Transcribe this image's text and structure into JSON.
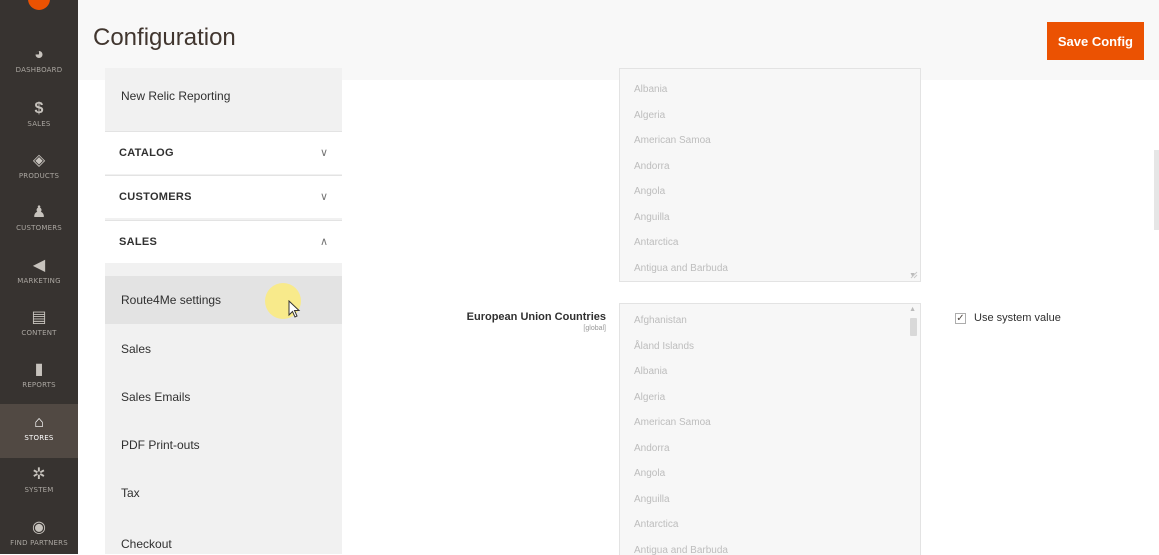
{
  "admin_menu": [
    {
      "label": "DASHBOARD",
      "icon": "dashboard-icon",
      "glyph": "◕"
    },
    {
      "label": "SALES",
      "icon": "dollar-icon",
      "glyph": "$"
    },
    {
      "label": "PRODUCTS",
      "icon": "cube-icon",
      "glyph": "◈"
    },
    {
      "label": "CUSTOMERS",
      "icon": "person-icon",
      "glyph": "♟"
    },
    {
      "label": "MARKETING",
      "icon": "megaphone-icon",
      "glyph": "◀"
    },
    {
      "label": "CONTENT",
      "icon": "layout-icon",
      "glyph": "▤"
    },
    {
      "label": "REPORTS",
      "icon": "bar-chart-icon",
      "glyph": "▮"
    },
    {
      "label": "STORES",
      "icon": "storefront-icon",
      "glyph": "⌂"
    },
    {
      "label": "SYSTEM",
      "icon": "gear-icon",
      "glyph": "✲"
    },
    {
      "label": "FIND PARTNERS",
      "icon": "partners-box-icon",
      "glyph": "◉"
    }
  ],
  "header": {
    "title": "Configuration",
    "save_label": "Save Config"
  },
  "config_nav": {
    "top_item": "New Relic Reporting",
    "sections": [
      {
        "label": "CATALOG",
        "chevron": "∨"
      },
      {
        "label": "CUSTOMERS",
        "chevron": "∨"
      },
      {
        "label": "SALES",
        "chevron": "∧"
      }
    ],
    "sales_items": [
      "Route4Me settings",
      "Sales",
      "Sales Emails",
      "PDF Print-outs",
      "Tax",
      "Checkout"
    ]
  },
  "top_countries": [
    "Albania",
    "Algeria",
    "American Samoa",
    "Andorra",
    "Angola",
    "Anguilla",
    "Antarctica",
    "Antigua and Barbuda"
  ],
  "eu_field": {
    "label": "European Union Countries",
    "scope": "[global]",
    "options": [
      "Afghanistan",
      "Åland Islands",
      "Albania",
      "Algeria",
      "American Samoa",
      "Andorra",
      "Angola",
      "Anguilla",
      "Antarctica",
      "Antigua and Barbuda"
    ],
    "use_system_value": "Use system value",
    "checked": true
  },
  "colors": {
    "accent": "#eb5202",
    "menu_bg": "#373330",
    "nav_bg": "#f1f1f1"
  }
}
